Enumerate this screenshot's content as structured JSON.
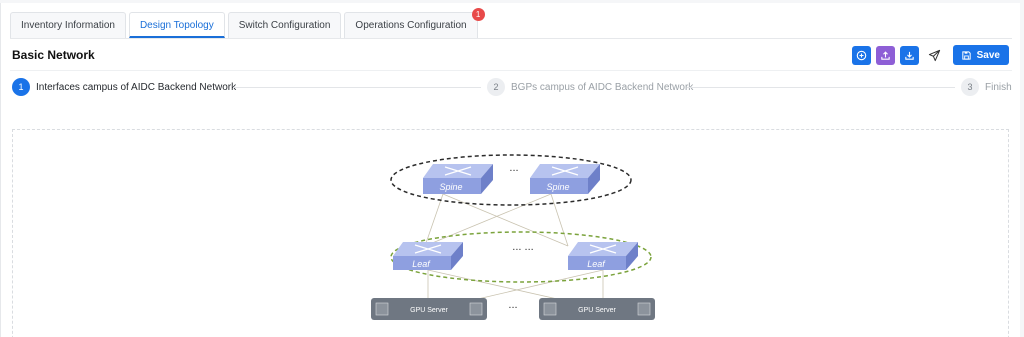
{
  "tabs": [
    {
      "label": "Inventory Information"
    },
    {
      "label": "Design Topology",
      "active": true
    },
    {
      "label": "Switch Configuration"
    },
    {
      "label": "Operations Configuration",
      "badge": "1"
    }
  ],
  "page": {
    "title": "Basic Network"
  },
  "toolbar": {
    "icons": [
      "add-circle-icon",
      "upload-icon",
      "download-icon",
      "send-icon"
    ],
    "save_label": "Save"
  },
  "steps": [
    {
      "number": "1",
      "label": "Interfaces campus of AIDC Backend Network",
      "state": "active"
    },
    {
      "number": "2",
      "label": "BGPs campus of AIDC Backend Network",
      "state": "idle"
    },
    {
      "number": "3",
      "label": "Finish",
      "state": "idle"
    }
  ],
  "diagram": {
    "spine_label": "Spine",
    "leaf_label": "Leaf",
    "server_label": "GPU Server",
    "ellipsis_top": "...",
    "ellipsis_mid": "... ...",
    "ellipsis_bottom": "...",
    "colors": {
      "switch": "#8e9fe0",
      "switch_top": "#b7c3ef",
      "server": "#6f7782",
      "spine_ring": "#2b2b2b",
      "leaf_ring": "#7ba33c"
    }
  }
}
